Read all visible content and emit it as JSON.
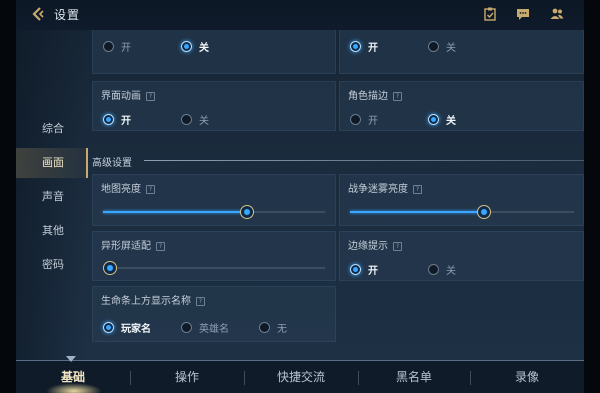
{
  "header": {
    "title": "设置"
  },
  "nav": {
    "items": [
      "综合",
      "画面",
      "声音",
      "其他",
      "密码"
    ],
    "active_index": 1
  },
  "top_partial": {
    "left": {
      "options": [
        "开",
        "关"
      ],
      "selected": 1
    },
    "right": {
      "options": [
        "开",
        "关"
      ],
      "selected": 0
    }
  },
  "cards": {
    "ui_animation": {
      "title": "界面动画",
      "options": [
        "开",
        "关"
      ],
      "selected": 0
    },
    "outline": {
      "title": "角色描边",
      "options": [
        "开",
        "关"
      ],
      "selected": 1
    },
    "advanced_label": "高级设置",
    "map_brightness": {
      "title": "地图亮度",
      "value": 0.65
    },
    "fog_brightness": {
      "title": "战争迷雾亮度",
      "value": 0.6
    },
    "notch_adapt": {
      "title": "异形屏适配",
      "value": 0.0
    },
    "edge_hint": {
      "title": "边缘提示",
      "options": [
        "开",
        "关"
      ],
      "selected": 0
    },
    "name_display": {
      "title": "生命条上方显示名称",
      "options": [
        "玩家名",
        "英雄名",
        "无"
      ],
      "selected": 0
    }
  },
  "tabs": {
    "items": [
      "基础",
      "操作",
      "快捷交流",
      "黑名单",
      "录像"
    ],
    "active_index": 0
  },
  "colors": {
    "accent": "#3aa6ff",
    "gold": "#c8aa6e"
  }
}
